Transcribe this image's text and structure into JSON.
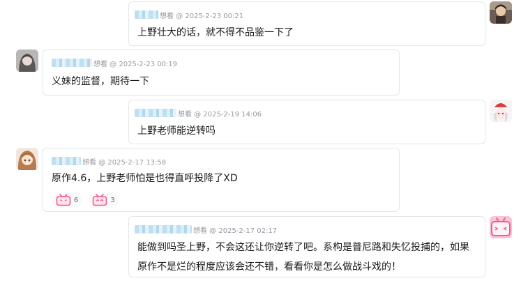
{
  "comments": [
    {
      "side": "right",
      "meta": "想看 @ 2025-2-23 00:21",
      "text": "上野壮大的话，就不得不品鉴一下了",
      "avatar": "avatar-dark-figure"
    },
    {
      "side": "left",
      "meta": "想看 @ 2025-2-23 00:19",
      "text": "义妹的监督，期待一下",
      "avatar": "avatar-gray-girl"
    },
    {
      "side": "right",
      "meta": "想看 @ 2025-2-19 14:06",
      "text": "上野老师能逆转吗",
      "avatar": "avatar-santa-girl"
    },
    {
      "side": "left",
      "meta": "想看 @ 2025-2-17 13:58",
      "text": "原作4.6，上野老师怕是也得直呼投降了XD",
      "avatar": "avatar-brown-hair-girl",
      "reactions": [
        {
          "icon": "bilibili-tv-icon",
          "count": "6"
        },
        {
          "icon": "bilibili-tv-icon",
          "count": "3"
        }
      ]
    },
    {
      "side": "right",
      "meta": "想看 @ 2025-2-17 02:17",
      "text": "能做到吗圣上野，不会这还让你逆转了吧。系构是普尼路和失忆投捕的，如果原作不是烂的程度应该会还不错，看看你是怎么做战斗戏的！",
      "avatar": "avatar-pink-tv"
    }
  ],
  "colors": {
    "border": "#e3e5e7",
    "meta_text": "#9499a0",
    "body_text": "#18191c",
    "tv_icon_pink": "#f25d8e"
  }
}
